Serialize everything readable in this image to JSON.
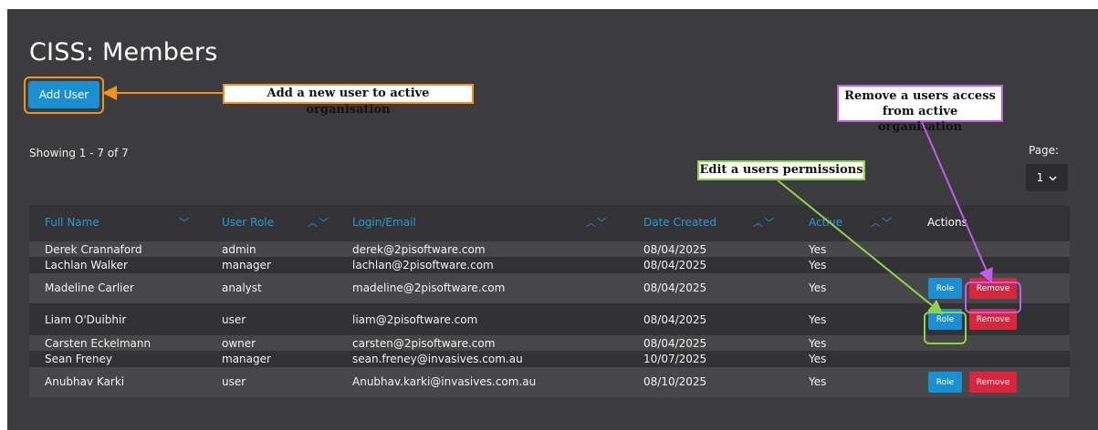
{
  "page": {
    "title": "CISS: Members",
    "add_user_label": "Add User",
    "showing": "Showing 1 - 7 of 7"
  },
  "pagination": {
    "label": "Page:",
    "value": "1",
    "chevron": "chevron-down-icon"
  },
  "columns": [
    {
      "label": "Full Name",
      "sort": "desc"
    },
    {
      "label": "User Role",
      "sort": "both"
    },
    {
      "label": "Login/Email",
      "sort": "both"
    },
    {
      "label": "Date Created",
      "sort": "both"
    },
    {
      "label": "Active",
      "sort": "both"
    },
    {
      "label": "Actions",
      "sort": "none"
    }
  ],
  "rows": [
    {
      "name": "Derek Crannaford",
      "role": "admin",
      "email": "derek@2pisoftware.com",
      "date": "08/04/2025",
      "active": "Yes",
      "actions": false
    },
    {
      "name": "Lachlan Walker",
      "role": "manager",
      "email": "lachlan@2pisoftware.com",
      "date": "08/04/2025",
      "active": "Yes",
      "actions": false
    },
    {
      "name": "Madeline Carlier",
      "role": "analyst",
      "email": "madeline@2pisoftware.com",
      "date": "08/04/2025",
      "active": "Yes",
      "actions": true
    },
    {
      "name": "Liam O'Duibhir",
      "role": "user",
      "email": "liam@2pisoftware.com",
      "date": "08/04/2025",
      "active": "Yes",
      "actions": true
    },
    {
      "name": "Carsten Eckelmann",
      "role": "owner",
      "email": "carsten@2pisoftware.com",
      "date": "08/04/2025",
      "active": "Yes",
      "actions": false
    },
    {
      "name": "Sean Freney",
      "role": "manager",
      "email": "sean.freney@invasives.com.au",
      "date": "10/07/2025",
      "active": "Yes",
      "actions": false
    },
    {
      "name": "Anubhav Karki",
      "role": "user",
      "email": "Anubhav.karki@invasives.com.au",
      "date": "08/10/2025",
      "active": "Yes",
      "actions": true
    }
  ],
  "buttons": {
    "role": "Role",
    "remove": "Remove"
  },
  "annotations": {
    "add": "Add a new user to active organisation",
    "edit": "Edit a users permissions",
    "remove": "Remove a users access from active organisation"
  },
  "colors": {
    "accent": "#1b8fd0",
    "danger": "#d8263d",
    "ann_orange": "#f0921e",
    "ann_green": "#8fd14f",
    "ann_purple": "#c05cf0"
  }
}
